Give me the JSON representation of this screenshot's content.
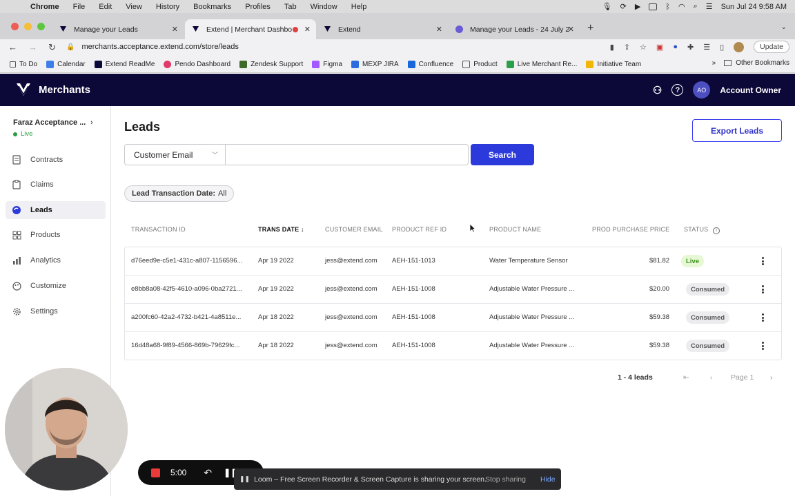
{
  "macos": {
    "app": "Chrome",
    "menu": [
      "File",
      "Edit",
      "View",
      "History",
      "Bookmarks",
      "Profiles",
      "Tab",
      "Window",
      "Help"
    ],
    "clock": "Sun Jul 24  9:58 AM"
  },
  "tabs": [
    {
      "title": "Manage your Leads"
    },
    {
      "title": "Extend | Merchant Dashbo"
    },
    {
      "title": "Extend"
    },
    {
      "title": "Manage your Leads - 24 July 2"
    }
  ],
  "address": {
    "url": "merchants.acceptance.extend.com/store/leads",
    "update_label": "Update"
  },
  "bookmarks": [
    "To Do",
    "Calendar",
    "Extend ReadMe",
    "Pendo Dashboard",
    "Zendesk Support",
    "Figma",
    "MEXP JIRA",
    "Confluence",
    "Product",
    "Live Merchant Re...",
    "Initiative Team"
  ],
  "bookmarks_other": "Other Bookmarks",
  "header": {
    "brand": "Merchants",
    "avatar_initials": "AO",
    "account": "Account Owner"
  },
  "sidebar": {
    "store": "Faraz Acceptance ...",
    "status": "Live",
    "items": [
      {
        "label": "Contracts",
        "icon": "document-icon"
      },
      {
        "label": "Claims",
        "icon": "clipboard-icon"
      },
      {
        "label": "Leads",
        "icon": "leads-icon"
      },
      {
        "label": "Products",
        "icon": "grid-icon"
      },
      {
        "label": "Analytics",
        "icon": "chart-icon"
      },
      {
        "label": "Customize",
        "icon": "brush-icon"
      },
      {
        "label": "Settings",
        "icon": "gear-icon"
      }
    ],
    "active": "Leads"
  },
  "page": {
    "title": "Leads",
    "export_label": "Export Leads",
    "search_field": "Customer Email",
    "search_value": "",
    "search_label": "Search",
    "filter_label": "Lead Transaction Date:",
    "filter_value": "All"
  },
  "table": {
    "columns": [
      "TRANSACTION ID",
      "TRANS DATE",
      "CUSTOMER EMAIL",
      "PRODUCT REF ID",
      "PRODUCT NAME",
      "PROD PURCHASE PRICE",
      "STATUS"
    ],
    "sorted_column": "TRANS DATE",
    "sort_direction": "descending",
    "rows": [
      {
        "id": "d76eed9e-c5e1-431c-a807-1156596...",
        "date": "Apr 19 2022",
        "email": "jess@extend.com",
        "ref": "AEH-151-1013",
        "name": "Water Temperature Sensor",
        "price": "$81.82",
        "status": "Live"
      },
      {
        "id": "e8bb8a08-42f5-4610-a096-0ba2721...",
        "date": "Apr 19 2022",
        "email": "jess@extend.com",
        "ref": "AEH-151-1008",
        "name": "Adjustable Water Pressure ...",
        "price": "$20.00",
        "status": "Consumed"
      },
      {
        "id": "a200fc60-42a2-4732-b421-4a8511e...",
        "date": "Apr 18 2022",
        "email": "jess@extend.com",
        "ref": "AEH-151-1008",
        "name": "Adjustable Water Pressure ...",
        "price": "$59.38",
        "status": "Consumed"
      },
      {
        "id": "16d48a68-9f89-4566-869b-79629fc...",
        "date": "Apr 18 2022",
        "email": "jess@extend.com",
        "ref": "AEH-151-1008",
        "name": "Adjustable Water Pressure ...",
        "price": "$59.38",
        "status": "Consumed"
      }
    ]
  },
  "pager": {
    "summary": "1 - 4 leads",
    "page": "Page 1"
  },
  "recorder": {
    "time": "5:00",
    "banner": "Loom – Free Screen Recorder & Screen Capture is sharing your screen.",
    "stop_sharing": "Stop sharing",
    "hide": "Hide"
  },
  "colors": {
    "nav_bg": "#0c0838",
    "accent": "#2d3adb",
    "live_badge": "#e6f8d4",
    "live_text": "#3c8f1b"
  }
}
